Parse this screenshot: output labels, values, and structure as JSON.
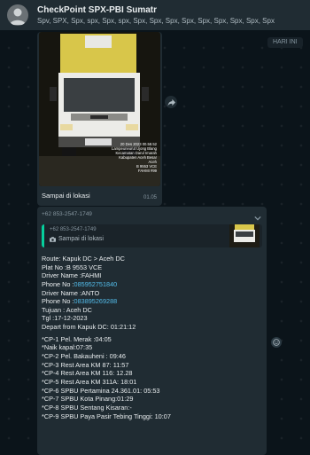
{
  "header": {
    "title": "CheckPoint SPX-PBI Sumatr",
    "members": "Spv, SPX, Spx, spx, Spx, spx, Spx, Spx, Spx, Spx, Spx, Spx, Spx, Spx, Spx"
  },
  "date_chip": "HARI INI",
  "photo_message": {
    "stamp_lines": [
      "20 Des 2023 00.58.52",
      "Lampeuneurut Ujong Blang",
      "Kecamatan Darul Imarah",
      "Kabupaten Aceh Besar",
      "Aceh",
      "B 9553 VCE",
      "FAHMI #99"
    ],
    "caption": "Sampai di lokasi",
    "time": "01.05"
  },
  "text_message": {
    "sender": "+62 853-2547-1749",
    "quote": {
      "phone": "+62 853-2547-1749",
      "text": "Sampai di lokasi"
    },
    "route": "Route: Kapuk DC > Aceh DC",
    "plat": "Plat No :B 9553 VCE",
    "driver1_name": "Driver Name :FAHMI",
    "driver1_phone_label": "Phone No :",
    "driver1_phone": "085952751840",
    "driver2_name": "Driver Name :ANTO",
    "driver2_phone_label": "Phone No :",
    "driver2_phone": "083895269288",
    "tujuan": "Tujuan : Aceh DC",
    "tgl": "Tgl :17-12-2023",
    "depart": "Depart from Kapuk DC: 01:21:12",
    "checkpoints": [
      "*CP-1 Pel. Merak :04:05",
      "*Naik kapal:07:35",
      "*CP-2 Pel. Bakauheni : 09:46",
      "*CP-3 Rest Area KM 87: 11:57",
      "*CP-4 Rest Area KM 116: 12.28",
      "*CP-5 Rest Area KM 311A: 18:01",
      "*CP-6 SPBU Pertamina 24.361.01: 05:53",
      "*CP-7 SPBU Kota Pinang:01:29",
      "*CP-8 SPBU Sentang Kisaran:-",
      "*CP-9 SPBU Paya Pasir Tebing Tinggi: 10:07"
    ]
  },
  "icons": {
    "avatar": "user-avatar-icon",
    "forward": "forward-icon",
    "chevron": "chevron-down-icon",
    "camera": "camera-icon",
    "emoji": "emoji-reaction-icon"
  },
  "colors": {
    "background": "#0b141a",
    "bubble": "#202c33",
    "header": "#202c33",
    "link": "#53bdeb",
    "quote_bar": "#06cf9c",
    "meta": "#8696a0"
  }
}
